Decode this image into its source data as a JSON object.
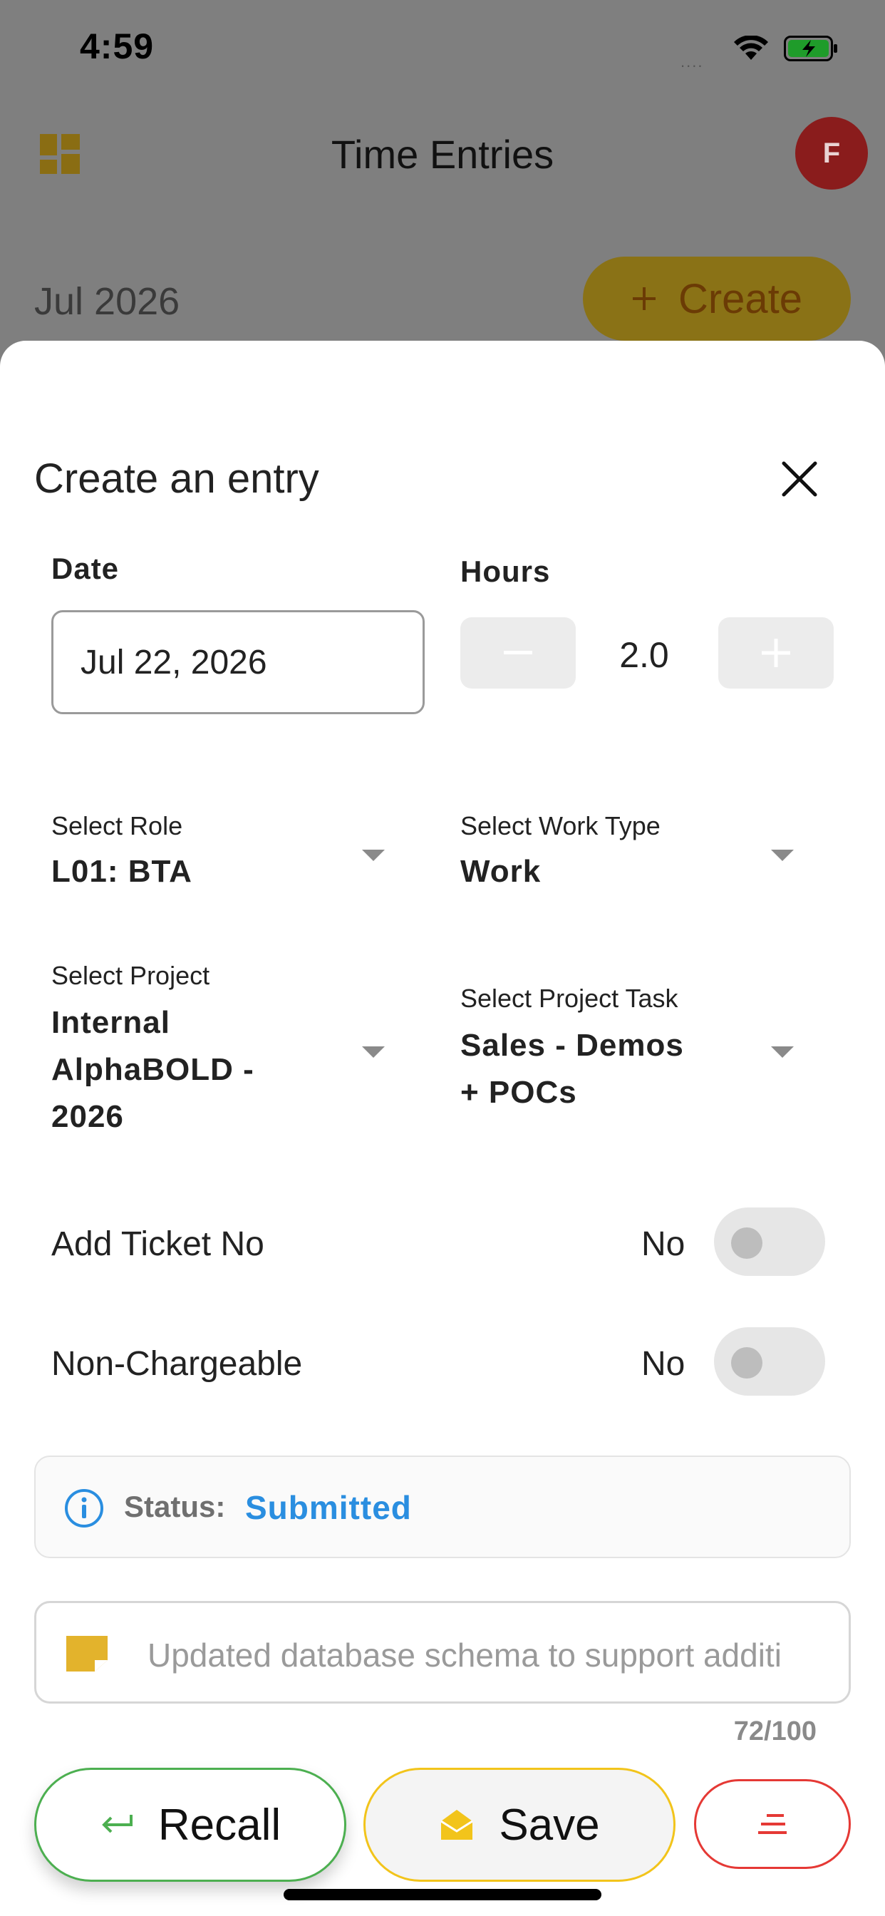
{
  "status_bar": {
    "time": "4:59",
    "signal": "....",
    "icons": [
      "wifi-icon",
      "battery-charging-icon"
    ]
  },
  "header": {
    "title": "Time Entries",
    "avatar_initial": "F"
  },
  "month": {
    "label": "Jul 2026",
    "create_label": "Create"
  },
  "sheet": {
    "title": "Create an entry",
    "date_label": "Date",
    "date_value": "Jul 22, 2026",
    "hours_label": "Hours",
    "hours_value": "2.0",
    "role": {
      "label": "Select Role",
      "value": "L01: BTA"
    },
    "work_type": {
      "label": "Select Work Type",
      "value": "Work"
    },
    "project": {
      "label": "Select Project",
      "value_lines": [
        "Internal",
        "AlphaBOLD -",
        "2026"
      ]
    },
    "project_task": {
      "label": "Select Project Task",
      "value_lines": [
        "Sales - Demos",
        "+ POCs"
      ]
    },
    "ticket": {
      "label": "Add Ticket No",
      "value": "No"
    },
    "non_chargeable": {
      "label": "Non-Chargeable",
      "value": "No"
    },
    "status": {
      "key": "Status:",
      "value": "Submitted"
    },
    "notes": {
      "text": "Updated database schema to support additi",
      "counter": "72/100"
    },
    "actions": {
      "recall_label": "Recall",
      "save_label": "Save"
    }
  },
  "colors": {
    "accent_yellow": "#f2c41b",
    "recall_green": "#4caf50",
    "menu_red": "#e53935",
    "status_blue": "#2a8ee0"
  }
}
